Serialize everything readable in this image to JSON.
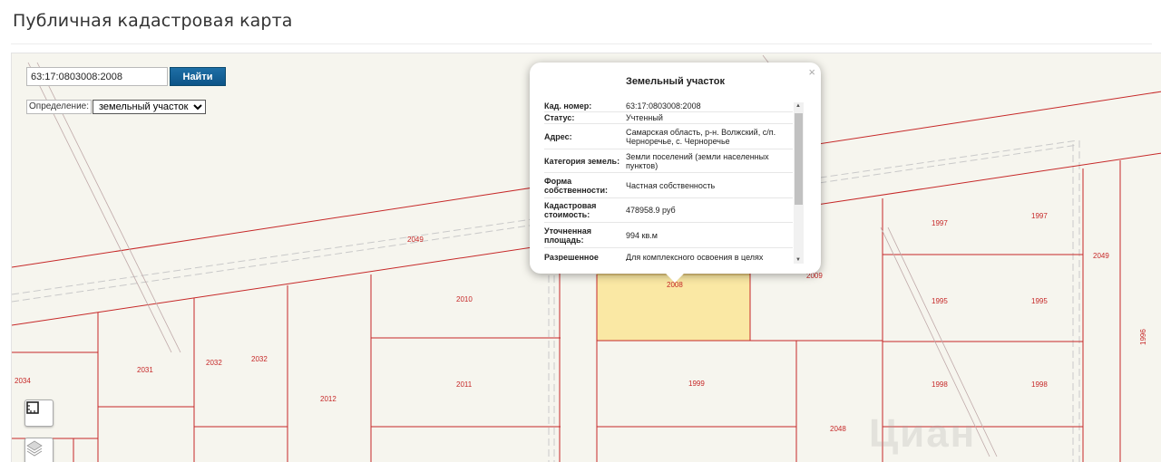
{
  "page": {
    "title": "Публичная кадастровая карта"
  },
  "search": {
    "value": "63:17:0803008:2008",
    "button_label": "Найти"
  },
  "definition": {
    "label": "Определение:",
    "selected": "земельный участок"
  },
  "map": {
    "parcel_labels": [
      "2049",
      "2010",
      "2008",
      "2009",
      "1997",
      "1997",
      "2049",
      "1995",
      "1995",
      "1996",
      "2031",
      "2032",
      "2032",
      "2034",
      "2011",
      "2012",
      "1999",
      "1998",
      "1998",
      "2048"
    ],
    "colors": {
      "boundary": "#c62828",
      "highlight_fill": "#fae8a4",
      "highlight_border": "#d6a73b",
      "background": "#f6f5ee"
    }
  },
  "watermark": "Циан",
  "popup": {
    "title": "Земельный участок",
    "close": "×",
    "rows": [
      {
        "key": "Кад. номер:",
        "value": "63:17:0803008:2008"
      },
      {
        "key": "Статус:",
        "value": "Учтенный"
      },
      {
        "key": "Адрес:",
        "value": "Самарская область, р-н. Волжский, с/п. Черноречье, с. Черноречье"
      },
      {
        "key": "Категория земель:",
        "value": "Земли поселений (земли населенных пунктов)"
      },
      {
        "key": "Форма собственности:",
        "value": "Частная собственность"
      },
      {
        "key": "Кадастровая стоимость:",
        "value": "478958.9 руб"
      },
      {
        "key": "Уточненная площадь:",
        "value": "994 кв.м"
      },
      {
        "key": "Разрешенное",
        "value": "Для комплексного освоения в целях"
      }
    ]
  },
  "tools": {
    "ruler_icon": "ruler-icon",
    "layers_icon": "layers-icon"
  }
}
